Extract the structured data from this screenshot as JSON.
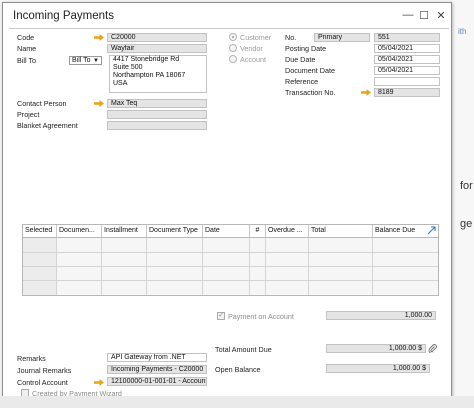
{
  "background": {
    "link_fragment": "ith",
    "text_1": "for",
    "text_2": "ge"
  },
  "window": {
    "title": "Incoming Payments",
    "controls": {
      "minimize": "—",
      "maximize": "☐",
      "close": "✕"
    }
  },
  "header_left": {
    "code_label": "Code",
    "code_value": "C20000",
    "name_label": "Name",
    "name_value": "Wayfair",
    "bill_to_label": "Bill To",
    "bill_to_select": "Bill To",
    "address_lines": [
      "4417 Stonebridge Rd",
      "Suite 500",
      "Northampton PA  18067",
      "USA"
    ],
    "contact_label": "Contact Person",
    "contact_value": "Max Teq",
    "project_label": "Project",
    "project_value": "",
    "blanket_label": "Blanket Agreement",
    "blanket_value": ""
  },
  "payee_type": {
    "options": [
      "Customer",
      "Vendor",
      "Account"
    ],
    "selected": "Customer"
  },
  "header_right": {
    "no_label": "No.",
    "series_value": "Primary",
    "no_value": "551",
    "posting_label": "Posting Date",
    "posting_value": "05/04/2021",
    "due_label": "Due Date",
    "due_value": "05/04/2021",
    "doc_date_label": "Document Date",
    "doc_date_value": "05/04/2021",
    "reference_label": "Reference",
    "reference_value": "",
    "transaction_label": "Transaction No.",
    "transaction_value": "8189"
  },
  "table": {
    "columns": [
      "Selected",
      "Documen...",
      "Installment",
      "Document Type",
      "Date",
      "#",
      "Overdue ...",
      "Total",
      "Balance Due"
    ],
    "rows": [
      [
        "",
        "",
        "",
        "",
        "",
        "",
        "",
        "",
        ""
      ],
      [
        "",
        "",
        "",
        "",
        "",
        "",
        "",
        "",
        ""
      ],
      [
        "",
        "",
        "",
        "",
        "",
        "",
        "",
        "",
        ""
      ],
      [
        "",
        "",
        "",
        "",
        "",
        "",
        "",
        "",
        ""
      ]
    ]
  },
  "footer": {
    "payment_on_account_label": "Payment on Account",
    "payment_on_account_checked": true,
    "payment_on_account_value": "1,000.00",
    "total_amount_due_label": "Total Amount Due",
    "total_amount_due_value": "1,000.00 $",
    "open_balance_label": "Open Balance",
    "open_balance_value": "1,000.00 $",
    "remarks_label": "Remarks",
    "remarks_value": "API Gateway from .NET",
    "journal_label": "Journal Remarks",
    "journal_value": "Incoming Payments - C20000",
    "control_label": "Control Account",
    "control_value": "12100000-01-001-01 - Account",
    "wizard_label": "Created by Payment Wizard",
    "wizard_checked": false
  },
  "colors": {
    "link_arrow": "#e8a317",
    "field_gray": "#e4e4e4",
    "accent_blue": "#3a78c4"
  }
}
